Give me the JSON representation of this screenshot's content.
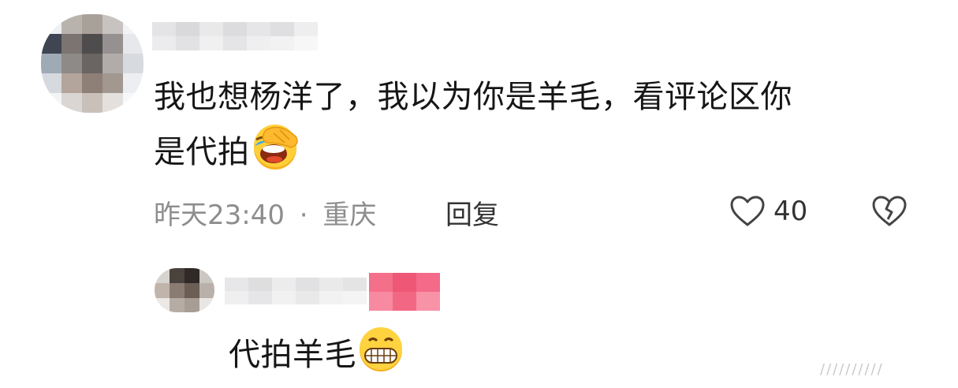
{
  "comment": {
    "text_line1": "我也想杨洋了，我以为你是羊毛，看评论区你",
    "text_line2": "是代拍",
    "emoji": "rolling-on-floor-laughing-emoji",
    "time": "昨天23:40",
    "dot": "·",
    "location": "重庆",
    "reply_label": "回复",
    "like_count": "40",
    "like_icon": "heart-outline-icon",
    "dislike_icon": "broken-heart-icon"
  },
  "reply_comment": {
    "text": "代拍羊毛",
    "emoji": "grinning-face-emoji",
    "badge_color": "#f05a7a"
  },
  "watermark": "//////////"
}
